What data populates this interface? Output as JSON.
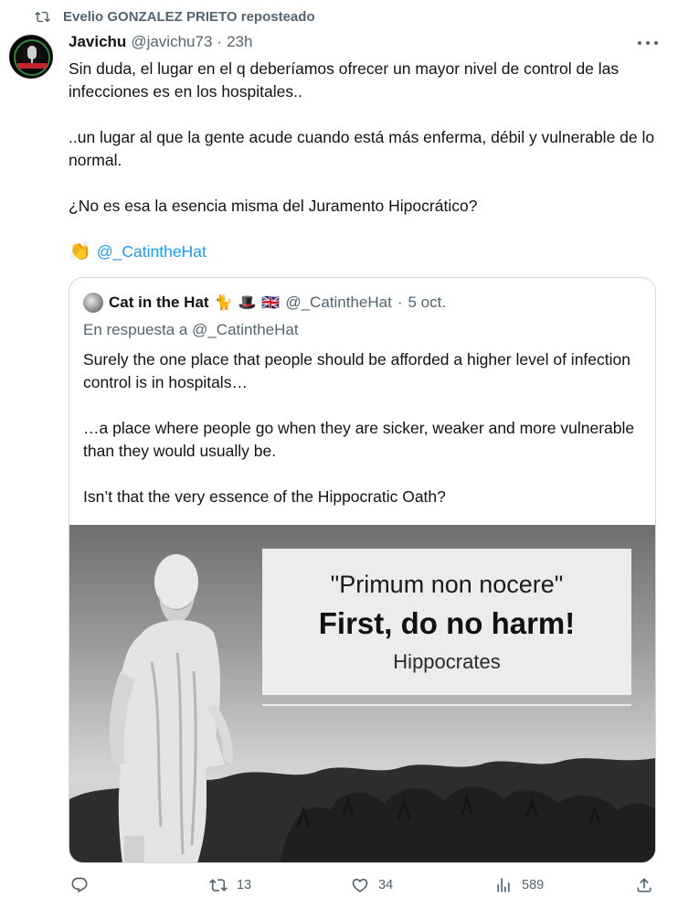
{
  "repost": {
    "label": "Evelio GONZALEZ PRIETO reposteado",
    "icon": "repost-icon"
  },
  "tweet": {
    "author_name": "Javichu",
    "handle": "@javichu73",
    "separator": "·",
    "time": "23h",
    "paragraphs": [
      "Sin duda, el lugar en el q deberíamos ofrecer un mayor nivel de control de las infecciones es en los hospitales..",
      "..un lugar al que la gente acude cuando está más enferma, débil y vulnerable de lo normal.",
      "¿No es esa la esencia misma del Juramento Hipocrático?"
    ],
    "clap_emoji": "👏",
    "mention": "@_CatintheHat"
  },
  "quote": {
    "author_name": "Cat in the Hat",
    "emojis": [
      "🐈",
      "🎩",
      "🇬🇧"
    ],
    "handle": "@_CatintheHat",
    "separator": "·",
    "date": "5 oct.",
    "reply_prefix": "En respuesta a",
    "reply_to": "@_CatintheHat",
    "paragraphs": [
      "Surely the one place that people should be afforded a higher level of infection control is in hospitals…",
      "…a place where people go when they are sicker, weaker and more vulnerable than they would usually be.",
      "Isn’t that the very essence of the Hippocratic Oath?"
    ],
    "image": {
      "line1": "\"Primum non nocere\"",
      "line2": "First, do no harm!",
      "line3": "Hippocrates"
    }
  },
  "actions": {
    "reply_count": "",
    "repost_count": "13",
    "like_count": "34",
    "views_count": "589"
  },
  "colors": {
    "text": "#0f1419",
    "secondary": "#536471",
    "link": "#1d9bf0",
    "border": "#cfd9de"
  }
}
